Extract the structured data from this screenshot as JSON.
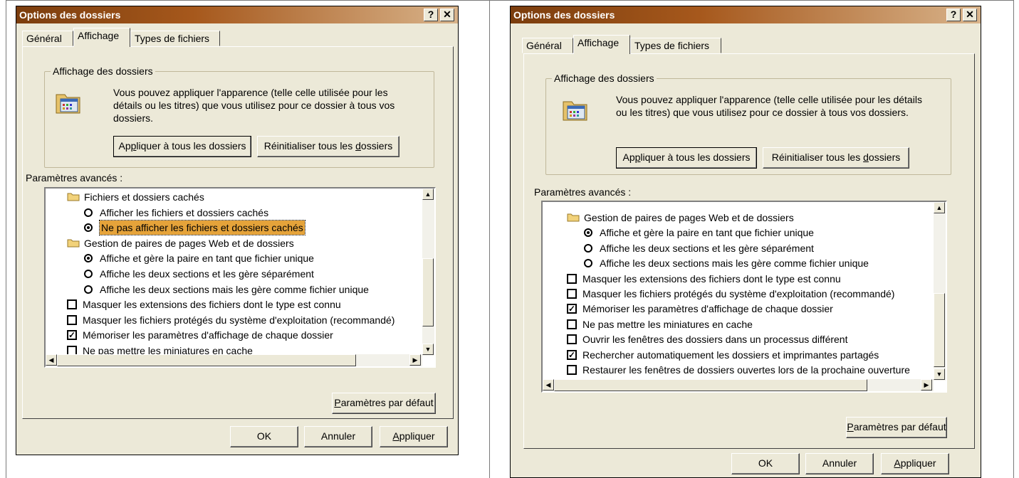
{
  "dialogs": [
    {
      "title": "Options des dossiers",
      "help_label": "?",
      "close_label": "✕",
      "tabs": [
        "Général",
        "Affichage",
        "Types de fichiers"
      ],
      "group_legend": "Affichage des dossiers",
      "group_text": "Vous pouvez appliquer l'apparence (telle celle utilisée pour les détails ou les titres) que vous utilisez pour ce dossier à tous vos dossiers.",
      "apply_all_label": "Appliquer à tous les dossiers",
      "reset_all_label": "Réinitialiser tous les dossiers",
      "advanced_label": "Paramètres avancés :",
      "settings": [
        {
          "type": "folder",
          "label": "Fichiers et dossiers cachés"
        },
        {
          "type": "radio",
          "checked": false,
          "label": "Afficher les fichiers et dossiers cachés"
        },
        {
          "type": "radio",
          "checked": true,
          "selected": true,
          "label": "Ne pas afficher les fichiers et dossiers cachés"
        },
        {
          "type": "folder",
          "label": "Gestion de paires de pages Web et de dossiers"
        },
        {
          "type": "radio",
          "checked": true,
          "label": "Affiche et gère la paire en tant que fichier unique"
        },
        {
          "type": "radio",
          "checked": false,
          "label": "Affiche les deux sections et les gère séparément"
        },
        {
          "type": "radio",
          "checked": false,
          "label": "Affiche les deux sections mais les gère comme fichier unique"
        },
        {
          "type": "check",
          "checked": false,
          "label": "Masquer les extensions des fichiers dont le type est connu"
        },
        {
          "type": "check",
          "checked": false,
          "label": "Masquer les fichiers protégés du système d'exploitation (recommandé)"
        },
        {
          "type": "check",
          "checked": true,
          "label": "Mémoriser les paramètres d'affichage de chaque dossier"
        },
        {
          "type": "check",
          "checked": false,
          "label": "Ne pas mettre les miniatures en cache"
        }
      ],
      "defaults_label": "Paramètres par défaut",
      "ok_label": "OK",
      "cancel_label": "Annuler",
      "apply_label": "Appliquer"
    },
    {
      "title": "Options des dossiers",
      "help_label": "?",
      "close_label": "✕",
      "tabs": [
        "Général",
        "Affichage",
        "Types de fichiers"
      ],
      "group_legend": "Affichage des dossiers",
      "group_text": "Vous pouvez appliquer l'apparence (telle celle utilisée pour les détails ou les titres) que vous utilisez pour ce dossier à tous vos dossiers.",
      "apply_all_label": "Appliquer à tous les dossiers",
      "reset_all_label": "Réinitialiser tous les dossiers",
      "advanced_label": "Paramètres avancés :",
      "settings": [
        {
          "type": "folder",
          "label": "Gestion de paires de pages Web et de dossiers"
        },
        {
          "type": "radio",
          "checked": true,
          "label": "Affiche et gère la paire en tant que fichier unique"
        },
        {
          "type": "radio",
          "checked": false,
          "label": "Affiche les deux sections et les gère séparément"
        },
        {
          "type": "radio",
          "checked": false,
          "label": "Affiche les deux sections mais les gère comme fichier unique"
        },
        {
          "type": "check",
          "checked": false,
          "label": "Masquer les extensions des fichiers dont le type est connu"
        },
        {
          "type": "check",
          "checked": false,
          "label": "Masquer les fichiers protégés du système d'exploitation (recommandé)"
        },
        {
          "type": "check",
          "checked": true,
          "label": "Mémoriser les paramètres d'affichage de chaque dossier"
        },
        {
          "type": "check",
          "checked": false,
          "label": "Ne pas mettre les miniatures en cache"
        },
        {
          "type": "check",
          "checked": false,
          "label": "Ouvrir les fenêtres des dossiers dans un processus différent"
        },
        {
          "type": "check",
          "checked": true,
          "label": "Rechercher automatiquement les dossiers et imprimantes partagés"
        },
        {
          "type": "check",
          "checked": false,
          "label": "Restaurer les fenêtres de dossiers ouvertes lors de la prochaine ouverture"
        }
      ],
      "defaults_label": "Paramètres par défaut",
      "ok_label": "OK",
      "cancel_label": "Annuler",
      "apply_label": "Appliquer"
    }
  ]
}
